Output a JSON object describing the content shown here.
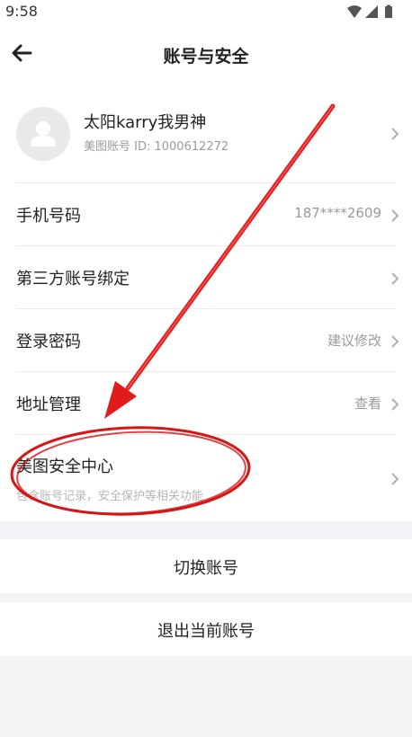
{
  "status_bar": {
    "time": "9:58"
  },
  "header": {
    "title": "账号与安全"
  },
  "profile": {
    "name": "太阳karry我男神",
    "id_line": "美图账号 ID:  1000612272"
  },
  "menu": [
    {
      "label": "手机号码",
      "value": "187****2609"
    },
    {
      "label": "第三方账号绑定",
      "value": ""
    },
    {
      "label": "登录密码",
      "value": "建议修改"
    },
    {
      "label": "地址管理",
      "value": "查看"
    }
  ],
  "security_center": {
    "label": "美图安全中心",
    "subtitle": "包含账号记录，安全保护等相关功能"
  },
  "actions": {
    "switch_account": "切换账号",
    "logout": "退出当前账号"
  },
  "annotation": {
    "arrow_color": "#e01b1b",
    "ellipse_color": "#d41616"
  },
  "icons": [
    "back-arrow-icon",
    "wifi-icon",
    "signal-icon",
    "battery-icon",
    "chevron-right-icon",
    "avatar-placeholder-icon"
  ]
}
